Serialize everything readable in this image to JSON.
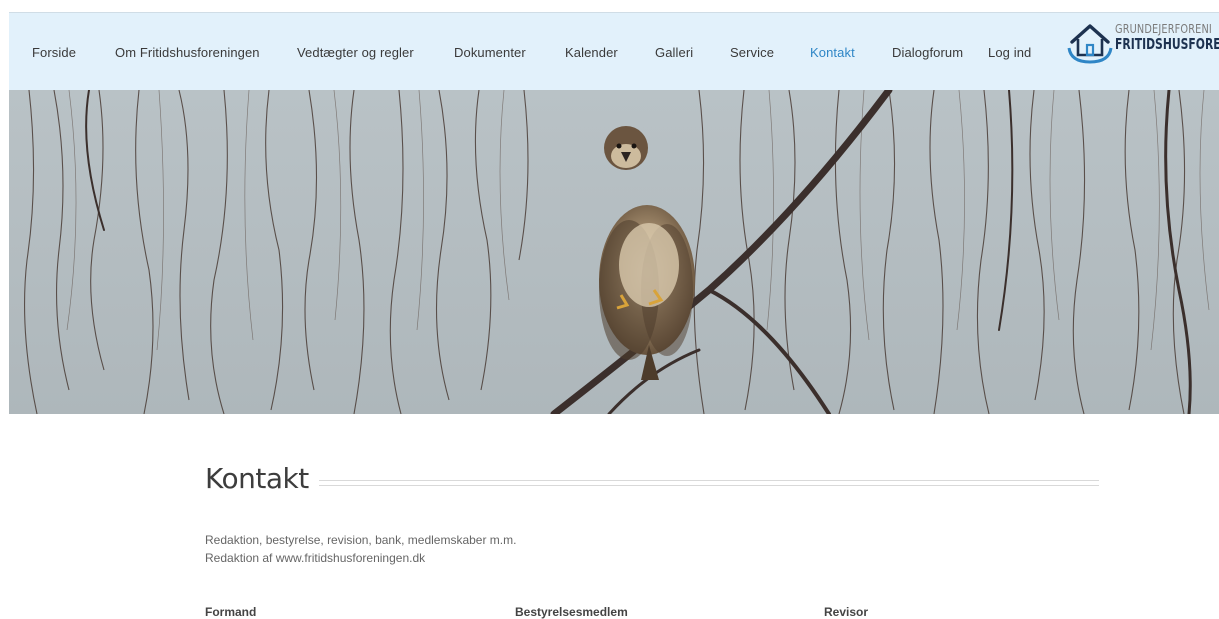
{
  "nav": {
    "items": [
      {
        "label": "Forside",
        "active": false
      },
      {
        "label": "Om Fritidshusforeningen",
        "active": false
      },
      {
        "label": "Vedtægter og regler",
        "active": false
      },
      {
        "label": "Dokumenter",
        "active": false
      },
      {
        "label": "Kalender",
        "active": false
      },
      {
        "label": "Galleri",
        "active": false
      },
      {
        "label": "Service",
        "active": false
      },
      {
        "label": "Kontakt",
        "active": true
      },
      {
        "label": "Dialogforum",
        "active": false
      },
      {
        "label": "Log ind",
        "active": false
      }
    ],
    "active_color": "#2f86c6"
  },
  "logo": {
    "line1": "GRUNDEJERFORENI",
    "line2": "FRITIDSHUSFOREI",
    "icon": "house-icon"
  },
  "hero": {
    "icon": "buzzard-on-branch-photo"
  },
  "main": {
    "title": "Kontakt",
    "intro_line1": "Redaktion, bestyrelse, revision, bank, medlemskaber m.m.",
    "intro_line2": "Redaktion af www.fritidshusforeningen.dk",
    "columns": [
      "Formand",
      "Bestyrelsesmedlem",
      "Revisor"
    ]
  },
  "colors": {
    "nav_bg": "#e2f1fb",
    "brand_dark": "#1d3250"
  }
}
